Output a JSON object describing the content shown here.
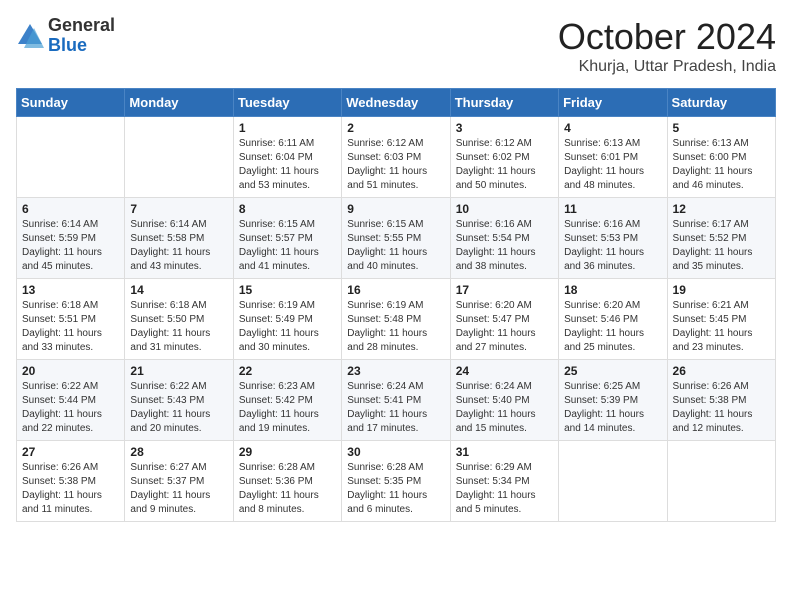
{
  "logo": {
    "general": "General",
    "blue": "Blue"
  },
  "title": "October 2024",
  "location": "Khurja, Uttar Pradesh, India",
  "days_of_week": [
    "Sunday",
    "Monday",
    "Tuesday",
    "Wednesday",
    "Thursday",
    "Friday",
    "Saturday"
  ],
  "weeks": [
    [
      {
        "day": "",
        "content": ""
      },
      {
        "day": "",
        "content": ""
      },
      {
        "day": "1",
        "content": "Sunrise: 6:11 AM\nSunset: 6:04 PM\nDaylight: 11 hours and 53 minutes."
      },
      {
        "day": "2",
        "content": "Sunrise: 6:12 AM\nSunset: 6:03 PM\nDaylight: 11 hours and 51 minutes."
      },
      {
        "day": "3",
        "content": "Sunrise: 6:12 AM\nSunset: 6:02 PM\nDaylight: 11 hours and 50 minutes."
      },
      {
        "day": "4",
        "content": "Sunrise: 6:13 AM\nSunset: 6:01 PM\nDaylight: 11 hours and 48 minutes."
      },
      {
        "day": "5",
        "content": "Sunrise: 6:13 AM\nSunset: 6:00 PM\nDaylight: 11 hours and 46 minutes."
      }
    ],
    [
      {
        "day": "6",
        "content": "Sunrise: 6:14 AM\nSunset: 5:59 PM\nDaylight: 11 hours and 45 minutes."
      },
      {
        "day": "7",
        "content": "Sunrise: 6:14 AM\nSunset: 5:58 PM\nDaylight: 11 hours and 43 minutes."
      },
      {
        "day": "8",
        "content": "Sunrise: 6:15 AM\nSunset: 5:57 PM\nDaylight: 11 hours and 41 minutes."
      },
      {
        "day": "9",
        "content": "Sunrise: 6:15 AM\nSunset: 5:55 PM\nDaylight: 11 hours and 40 minutes."
      },
      {
        "day": "10",
        "content": "Sunrise: 6:16 AM\nSunset: 5:54 PM\nDaylight: 11 hours and 38 minutes."
      },
      {
        "day": "11",
        "content": "Sunrise: 6:16 AM\nSunset: 5:53 PM\nDaylight: 11 hours and 36 minutes."
      },
      {
        "day": "12",
        "content": "Sunrise: 6:17 AM\nSunset: 5:52 PM\nDaylight: 11 hours and 35 minutes."
      }
    ],
    [
      {
        "day": "13",
        "content": "Sunrise: 6:18 AM\nSunset: 5:51 PM\nDaylight: 11 hours and 33 minutes."
      },
      {
        "day": "14",
        "content": "Sunrise: 6:18 AM\nSunset: 5:50 PM\nDaylight: 11 hours and 31 minutes."
      },
      {
        "day": "15",
        "content": "Sunrise: 6:19 AM\nSunset: 5:49 PM\nDaylight: 11 hours and 30 minutes."
      },
      {
        "day": "16",
        "content": "Sunrise: 6:19 AM\nSunset: 5:48 PM\nDaylight: 11 hours and 28 minutes."
      },
      {
        "day": "17",
        "content": "Sunrise: 6:20 AM\nSunset: 5:47 PM\nDaylight: 11 hours and 27 minutes."
      },
      {
        "day": "18",
        "content": "Sunrise: 6:20 AM\nSunset: 5:46 PM\nDaylight: 11 hours and 25 minutes."
      },
      {
        "day": "19",
        "content": "Sunrise: 6:21 AM\nSunset: 5:45 PM\nDaylight: 11 hours and 23 minutes."
      }
    ],
    [
      {
        "day": "20",
        "content": "Sunrise: 6:22 AM\nSunset: 5:44 PM\nDaylight: 11 hours and 22 minutes."
      },
      {
        "day": "21",
        "content": "Sunrise: 6:22 AM\nSunset: 5:43 PM\nDaylight: 11 hours and 20 minutes."
      },
      {
        "day": "22",
        "content": "Sunrise: 6:23 AM\nSunset: 5:42 PM\nDaylight: 11 hours and 19 minutes."
      },
      {
        "day": "23",
        "content": "Sunrise: 6:24 AM\nSunset: 5:41 PM\nDaylight: 11 hours and 17 minutes."
      },
      {
        "day": "24",
        "content": "Sunrise: 6:24 AM\nSunset: 5:40 PM\nDaylight: 11 hours and 15 minutes."
      },
      {
        "day": "25",
        "content": "Sunrise: 6:25 AM\nSunset: 5:39 PM\nDaylight: 11 hours and 14 minutes."
      },
      {
        "day": "26",
        "content": "Sunrise: 6:26 AM\nSunset: 5:38 PM\nDaylight: 11 hours and 12 minutes."
      }
    ],
    [
      {
        "day": "27",
        "content": "Sunrise: 6:26 AM\nSunset: 5:38 PM\nDaylight: 11 hours and 11 minutes."
      },
      {
        "day": "28",
        "content": "Sunrise: 6:27 AM\nSunset: 5:37 PM\nDaylight: 11 hours and 9 minutes."
      },
      {
        "day": "29",
        "content": "Sunrise: 6:28 AM\nSunset: 5:36 PM\nDaylight: 11 hours and 8 minutes."
      },
      {
        "day": "30",
        "content": "Sunrise: 6:28 AM\nSunset: 5:35 PM\nDaylight: 11 hours and 6 minutes."
      },
      {
        "day": "31",
        "content": "Sunrise: 6:29 AM\nSunset: 5:34 PM\nDaylight: 11 hours and 5 minutes."
      },
      {
        "day": "",
        "content": ""
      },
      {
        "day": "",
        "content": ""
      }
    ]
  ]
}
